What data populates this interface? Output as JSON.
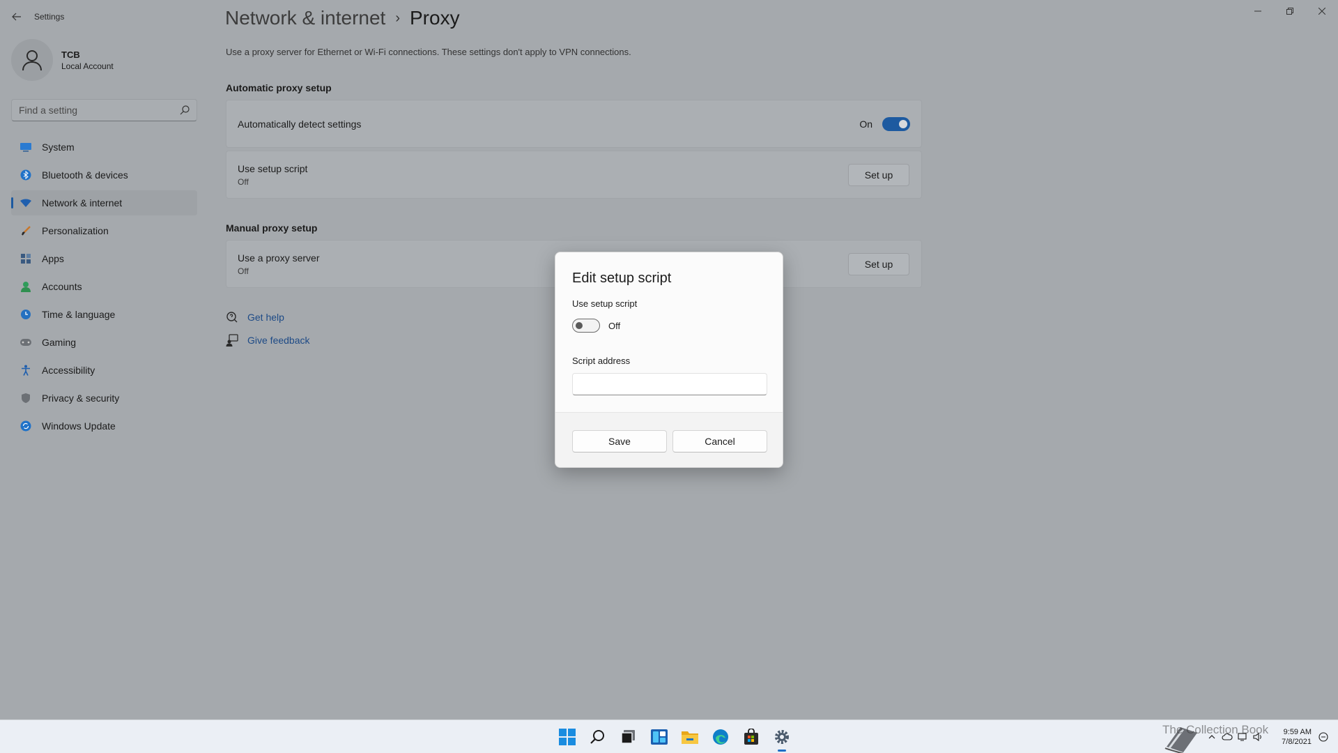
{
  "app": {
    "title": "Settings"
  },
  "profile": {
    "name": "TCB",
    "account_type": "Local Account"
  },
  "search": {
    "placeholder": "Find a setting"
  },
  "sidebar": {
    "items": [
      {
        "label": "System",
        "icon": "system-icon"
      },
      {
        "label": "Bluetooth & devices",
        "icon": "bluetooth-icon"
      },
      {
        "label": "Network & internet",
        "icon": "wifi-icon",
        "active": true
      },
      {
        "label": "Personalization",
        "icon": "brush-icon"
      },
      {
        "label": "Apps",
        "icon": "apps-icon"
      },
      {
        "label": "Accounts",
        "icon": "person-icon"
      },
      {
        "label": "Time & language",
        "icon": "globe-clock-icon"
      },
      {
        "label": "Gaming",
        "icon": "gamepad-icon"
      },
      {
        "label": "Accessibility",
        "icon": "accessibility-icon"
      },
      {
        "label": "Privacy & security",
        "icon": "shield-icon"
      },
      {
        "label": "Windows Update",
        "icon": "update-icon"
      }
    ]
  },
  "breadcrumb": {
    "parent": "Network & internet",
    "separator": "›",
    "current": "Proxy"
  },
  "description": "Use a proxy server for Ethernet or Wi-Fi connections. These settings don't apply to VPN connections.",
  "automatic": {
    "title": "Automatic proxy setup",
    "detect": {
      "label": "Automatically detect settings",
      "state": "On"
    },
    "script": {
      "label": "Use setup script",
      "status": "Off",
      "button": "Set up"
    }
  },
  "manual": {
    "title": "Manual proxy setup",
    "proxy": {
      "label": "Use a proxy server",
      "status": "Off",
      "button": "Set up"
    }
  },
  "help": {
    "get_help": "Get help",
    "give_feedback": "Give feedback"
  },
  "dialog": {
    "title": "Edit setup script",
    "toggle_label": "Use setup script",
    "toggle_state": "Off",
    "address_label": "Script address",
    "address_value": "",
    "save": "Save",
    "cancel": "Cancel"
  },
  "taskbar": {
    "apps": [
      "start-icon",
      "search-icon",
      "task-view-icon",
      "widgets-icon",
      "file-explorer-icon",
      "edge-icon",
      "store-icon",
      "settings-icon"
    ],
    "time": "9:59 AM",
    "date": "7/8/2021",
    "watermark": "The Collection Book"
  },
  "colors": {
    "accent": "#1d5aa0",
    "link": "#1d4a86",
    "overlay_bg": "#a5a9ad"
  }
}
